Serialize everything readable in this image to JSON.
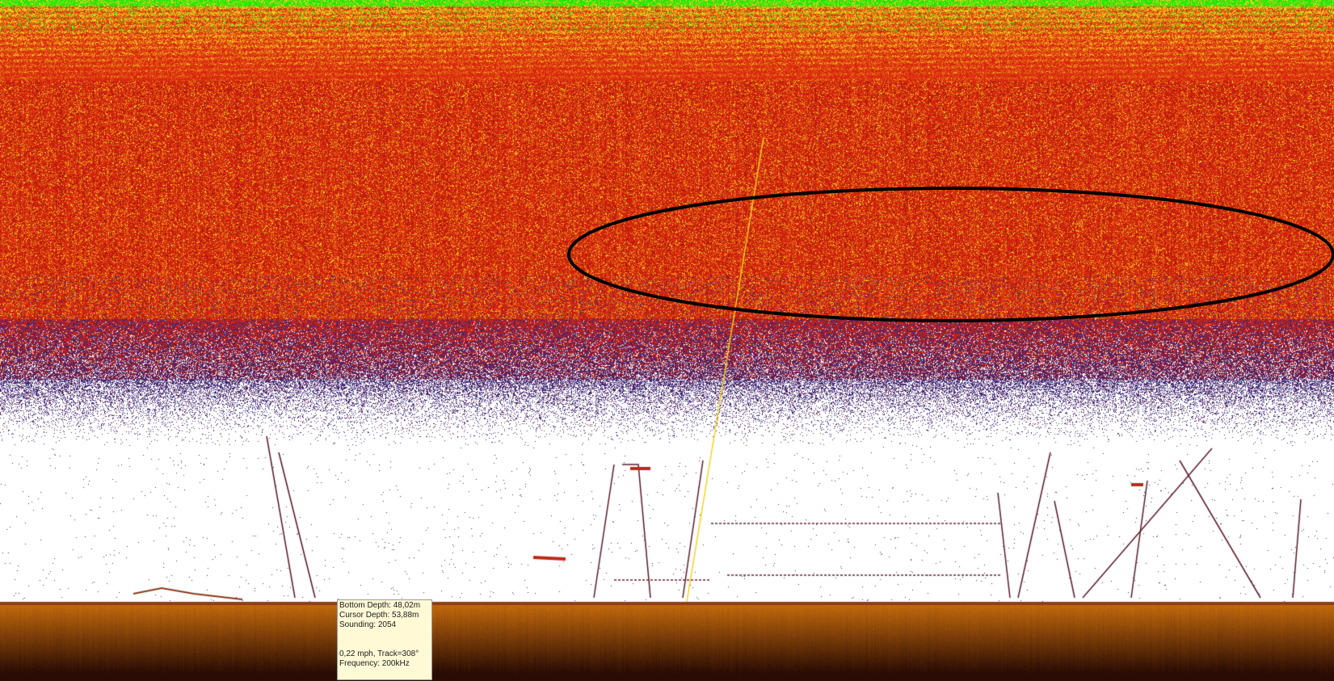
{
  "colors": {
    "surface_green": "#22e60a",
    "echo_yellow": "#f5d21e",
    "echo_red": "#d9260f",
    "echo_deep_red": "#a8140a",
    "echo_purple": "#3b2a7a",
    "background_white": "#ffffff",
    "bottom_orange": "#c46a0c",
    "sub_bottom_dark": "#2a0c04",
    "annotation_black": "#000000",
    "info_box_bg": "#fff9d6"
  },
  "info_box": {
    "bottom_depth": "Bottom Depth: 48,02m",
    "cursor_depth": "Cursor Depth: 53,88m",
    "sounding": "Sounding: 2054",
    "speed_track": "0,22 mph, Track=308°",
    "frequency": "Frequency: 200kHz"
  },
  "annotation": {
    "shape": "ellipse-icon"
  }
}
